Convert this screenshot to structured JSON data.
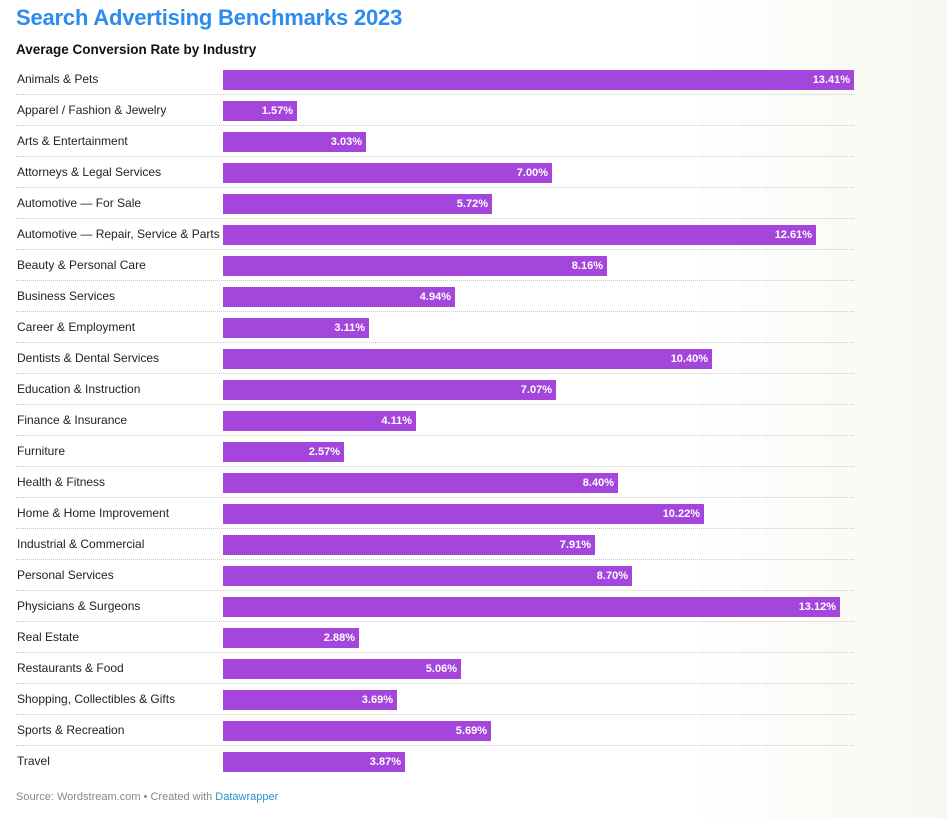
{
  "title": "Search Advertising Benchmarks 2023",
  "subtitle": "Average Conversion Rate by Industry",
  "footer": {
    "source_text": "Source: Wordstream.com • Created with ",
    "link_text": "Datawrapper"
  },
  "colors": {
    "title": "#2b8cee",
    "bar": "#a445dc",
    "link": "#2891c9"
  },
  "chart_data": {
    "type": "bar",
    "orientation": "horizontal",
    "title": "Search Advertising Benchmarks 2023",
    "subtitle": "Average Conversion Rate by Industry",
    "xlabel": "",
    "ylabel": "",
    "unit": "%",
    "xlim": [
      0,
      13.41
    ],
    "grid": false,
    "legend": "none",
    "categories": [
      "Animals & Pets",
      "Apparel / Fashion & Jewelry",
      "Arts & Entertainment",
      "Attorneys & Legal Services",
      "Automotive — For Sale",
      "Automotive — Repair, Service & Parts",
      "Beauty & Personal Care",
      "Business Services",
      "Career & Employment",
      "Dentists & Dental Services",
      "Education & Instruction",
      "Finance & Insurance",
      "Furniture",
      "Health & Fitness",
      "Home & Home Improvement",
      "Industrial & Commercial",
      "Personal Services",
      "Physicians & Surgeons",
      "Real Estate",
      "Restaurants & Food",
      "Shopping, Collectibles & Gifts",
      "Sports & Recreation",
      "Travel"
    ],
    "values": [
      13.41,
      1.57,
      3.03,
      7.0,
      5.72,
      12.61,
      8.16,
      4.94,
      3.11,
      10.4,
      7.07,
      4.11,
      2.57,
      8.4,
      10.22,
      7.91,
      8.7,
      13.12,
      2.88,
      5.06,
      3.69,
      5.69,
      3.87
    ],
    "value_labels": [
      "13.41%",
      "1.57%",
      "3.03%",
      "7.00%",
      "5.72%",
      "12.61%",
      "8.16%",
      "4.94%",
      "3.11%",
      "10.40%",
      "7.07%",
      "4.11%",
      "2.57%",
      "8.40%",
      "10.22%",
      "7.91%",
      "8.70%",
      "13.12%",
      "2.88%",
      "5.06%",
      "3.69%",
      "5.69%",
      "3.87%"
    ]
  }
}
